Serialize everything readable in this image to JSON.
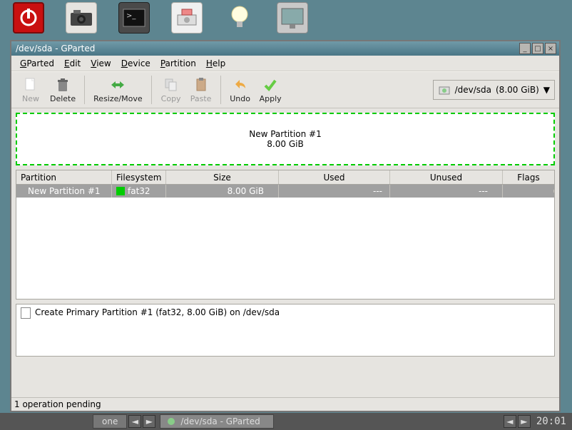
{
  "window": {
    "title": "/dev/sda - GParted"
  },
  "menubar": {
    "items": [
      {
        "ul": "G",
        "rest": "Parted"
      },
      {
        "ul": "E",
        "rest": "dit"
      },
      {
        "ul": "V",
        "rest": "iew"
      },
      {
        "ul": "D",
        "rest": "evice"
      },
      {
        "ul": "P",
        "rest": "artition"
      },
      {
        "ul": "H",
        "rest": "elp"
      }
    ]
  },
  "toolbar": {
    "new": "New",
    "delete": "Delete",
    "resize": "Resize/Move",
    "copy": "Copy",
    "paste": "Paste",
    "undo": "Undo",
    "apply": "Apply"
  },
  "device_selector": {
    "device": "/dev/sda",
    "size": "(8.00 GiB)"
  },
  "partition_visual": {
    "name": "New Partition #1",
    "size": "8.00 GiB"
  },
  "table": {
    "headers": {
      "partition": "Partition",
      "filesystem": "Filesystem",
      "size": "Size",
      "used": "Used",
      "unused": "Unused",
      "flags": "Flags"
    },
    "rows": [
      {
        "partition": "New Partition #1",
        "fs": "fat32",
        "size": "8.00 GiB",
        "used": "---",
        "unused": "---",
        "flags": ""
      }
    ]
  },
  "operations": {
    "text": "Create Primary Partition #1 (fat32, 8.00 GiB) on /dev/sda"
  },
  "statusbar": {
    "text": "1 operation pending"
  },
  "taskbar": {
    "workspace": "one",
    "task_title": "/dev/sda - GParted",
    "clock": "20:01"
  }
}
